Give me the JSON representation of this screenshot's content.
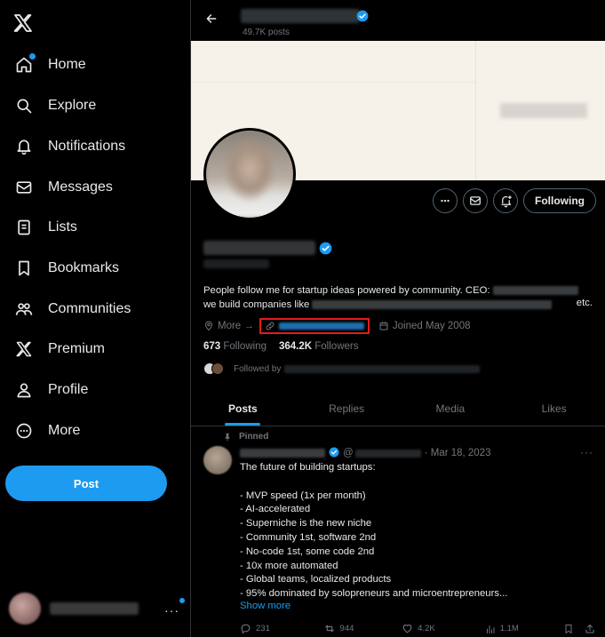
{
  "sidebar": {
    "logo": "x-logo-icon",
    "nav": [
      {
        "label": "Home",
        "icon": "home-icon",
        "badge": true
      },
      {
        "label": "Explore",
        "icon": "search-icon",
        "badge": false
      },
      {
        "label": "Notifications",
        "icon": "bell-icon",
        "badge": false
      },
      {
        "label": "Messages",
        "icon": "envelope-icon",
        "badge": false
      },
      {
        "label": "Lists",
        "icon": "list-icon",
        "badge": false
      },
      {
        "label": "Bookmarks",
        "icon": "bookmark-icon",
        "badge": false
      },
      {
        "label": "Communities",
        "icon": "people-icon",
        "badge": false
      },
      {
        "label": "Premium",
        "icon": "x-logo-icon",
        "badge": false
      },
      {
        "label": "Profile",
        "icon": "person-icon",
        "badge": false
      },
      {
        "label": "More",
        "icon": "more-circle-icon",
        "badge": false
      }
    ],
    "post_label": "Post",
    "account_more": "···"
  },
  "header": {
    "posts_count": "49.7K posts"
  },
  "profile": {
    "following_button": "Following",
    "bio_line1": "People follow me for startup ideas powered by community. CEO: ",
    "bio_line2": "we build companies like ",
    "bio_tail": "etc.",
    "more_label": "More →",
    "joined": "Joined May 2008",
    "following_count": "673",
    "following_label": "Following",
    "followers_count": "364.2K",
    "followers_label": "Followers",
    "followed_by": "Followed by"
  },
  "tabs": [
    {
      "label": "Posts",
      "active": true
    },
    {
      "label": "Replies",
      "active": false
    },
    {
      "label": "Media",
      "active": false
    },
    {
      "label": "Likes",
      "active": false
    }
  ],
  "tweet": {
    "pinned_label": "Pinned",
    "handle_prefix": "@",
    "date": "· Mar 18, 2023",
    "more": "···",
    "lines": [
      "The future of building startups:",
      "",
      "- MVP speed (1x per month)",
      "- AI-accelerated",
      "- Superniche is the new niche",
      "- Community 1st, software 2nd",
      "- No-code 1st, some code 2nd",
      "- 10x more automated",
      "- Global teams, localized products",
      "- 95% dominated by solopreneurs and microentrepreneurs..."
    ],
    "show_more": "Show more",
    "replies": "231",
    "reposts": "944",
    "likes": "4.2K",
    "views": "1.1M"
  },
  "colors": {
    "accent": "#1d9bf0",
    "background": "#000000",
    "text": "#e7e9ea",
    "muted": "#71767b",
    "border": "#2f3336",
    "highlight": "#e31b1b"
  }
}
